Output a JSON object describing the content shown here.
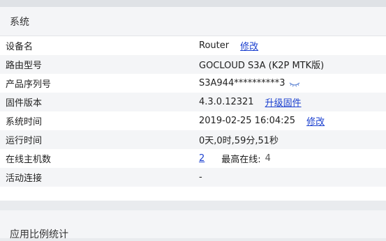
{
  "system_panel": {
    "title": "系统",
    "rows": [
      {
        "label": "设备名",
        "value": "Router",
        "action": "修改"
      },
      {
        "label": "路由型号",
        "value": "GOCLOUD S3A (K2P MTK版)"
      },
      {
        "label": "产品序列号",
        "value": "S3A944**********3",
        "icon": "eye-icon"
      },
      {
        "label": "固件版本",
        "value": "4.3.0.12321",
        "action": "升级固件"
      },
      {
        "label": "系统时间",
        "value": "2019-02-25 16:04:25",
        "action": "修改"
      },
      {
        "label": "运行时间",
        "value": "0天,0时,59分,51秒"
      },
      {
        "label": "在线主机数",
        "value": "2",
        "extra_label": "最高在线:",
        "extra_value": "4"
      },
      {
        "label": "活动连接",
        "value": "-"
      }
    ]
  },
  "next_panel": {
    "title": "应用比例统计"
  },
  "colors": {
    "link": "#1a3fcf",
    "header_bg": "#f4f5f7",
    "page_bg": "#e9ebee"
  }
}
